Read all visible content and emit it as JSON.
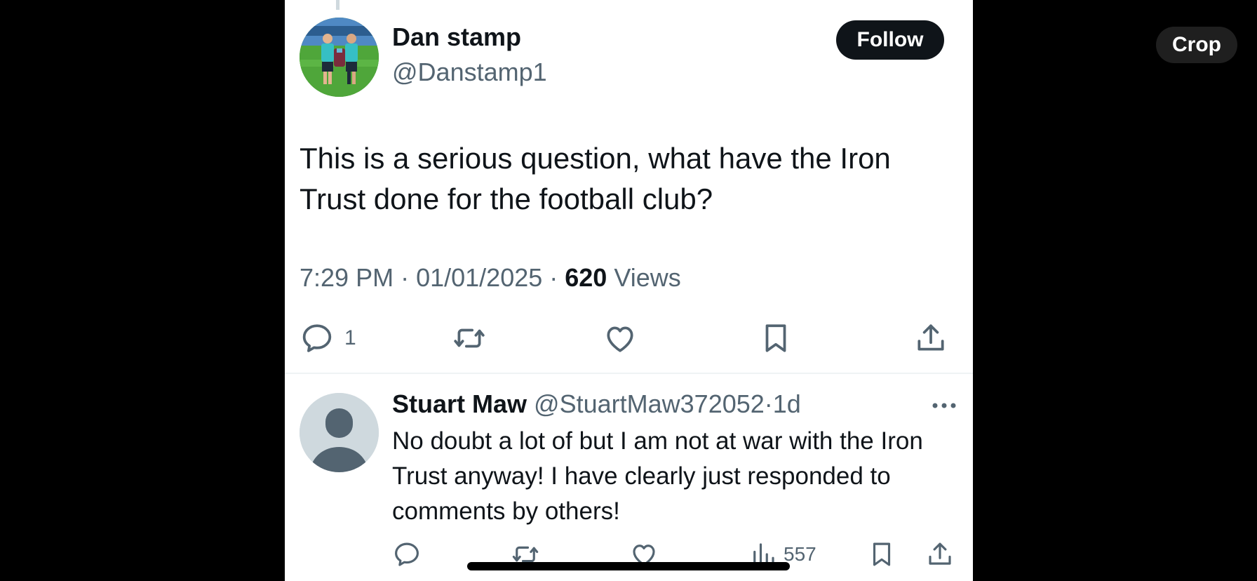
{
  "overlay": {
    "crop_label": "Crop"
  },
  "tweet": {
    "author_name": "Dan stamp",
    "author_handle": "@Danstamp1",
    "follow_label": "Follow",
    "text": "This is a serious question, what have the Iron Trust done for the football club?",
    "time": "7:29 PM",
    "date": "01/01/2025",
    "separator": " · ",
    "views_count": "620",
    "views_label": "Views",
    "actions": {
      "reply_icon": "reply-icon",
      "reply_count": "1",
      "retweet_icon": "retweet-icon",
      "like_icon": "heart-icon",
      "bookmark_icon": "bookmark-icon",
      "share_icon": "share-icon"
    }
  },
  "reply": {
    "author_name": "Stuart Maw",
    "author_handle": "@StuartMaw372052",
    "dot": "·",
    "time": "1d",
    "text": "No doubt a lot of but I am not at war with the Iron Trust anyway! I have clearly just responded to comments by others!",
    "views_count": "557",
    "actions": {
      "reply_icon": "reply-icon",
      "retweet_icon": "retweet-icon",
      "like_icon": "heart-icon",
      "views_icon": "views-chart-icon",
      "bookmark_icon": "bookmark-icon",
      "share_icon": "share-icon"
    }
  },
  "colors": {
    "text_primary": "#0f1419",
    "text_secondary": "#536471",
    "background": "#ffffff",
    "follow_button": "#0f1419"
  }
}
